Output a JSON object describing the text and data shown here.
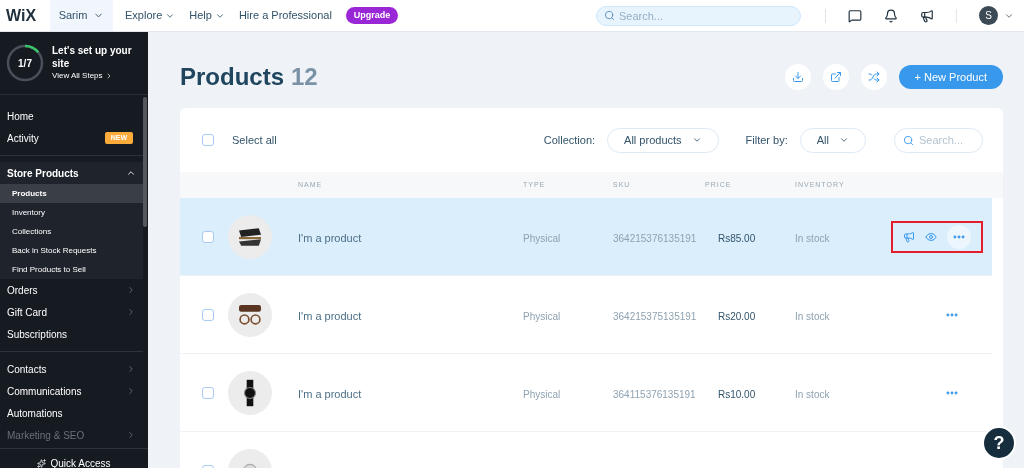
{
  "topbar": {
    "logo": "WiX",
    "site": "Sarim",
    "menu": [
      {
        "label": "Explore",
        "dropdown": true
      },
      {
        "label": "Help",
        "dropdown": true
      },
      {
        "label": "Hire a Professional",
        "dropdown": false
      }
    ],
    "upgrade": "Upgrade",
    "search": {
      "placeholder": "Search..."
    },
    "avatar": "S"
  },
  "setup": {
    "progress": "1/7",
    "level": 0.14,
    "title": "Let's set up your site",
    "link": "View All Steps"
  },
  "sidebar": {
    "sections": [
      [
        {
          "label": "Home",
          "kind": "link",
          "disabled": false
        },
        {
          "label": "Activity",
          "kind": "link",
          "badge": "NEW",
          "disabled": false
        }
      ],
      [
        {
          "label": "Store Products",
          "kind": "group",
          "expanded": true,
          "disabled": false,
          "children": [
            {
              "label": "Products",
              "selected": true
            },
            {
              "label": "Inventory",
              "selected": false
            },
            {
              "label": "Collections",
              "selected": false
            },
            {
              "label": "Back in Stock Requests",
              "selected": false
            },
            {
              "label": "Find Products to Sell",
              "selected": false
            }
          ]
        },
        {
          "label": "Orders",
          "kind": "submenu",
          "disabled": false
        },
        {
          "label": "Gift Card",
          "kind": "submenu",
          "disabled": false
        },
        {
          "label": "Subscriptions",
          "kind": "link",
          "disabled": false
        }
      ],
      [
        {
          "label": "Contacts",
          "kind": "submenu",
          "disabled": false
        },
        {
          "label": "Communications",
          "kind": "submenu",
          "disabled": false
        },
        {
          "label": "Automations",
          "kind": "link",
          "disabled": false
        },
        {
          "label": "Marketing & SEO",
          "kind": "submenu",
          "disabled": true
        }
      ]
    ],
    "quick_access": "Quick Access"
  },
  "page": {
    "title": "Products",
    "count": "12",
    "new_button": "+ New Product"
  },
  "toolbar": {
    "select_all_checked": false,
    "select_all": "Select all",
    "collection_label": "Collection:",
    "collection_value": "All products",
    "filter_label": "Filter by:",
    "filter_value": "All",
    "search": {
      "placeholder": "Search..."
    }
  },
  "table": {
    "columns": [
      "NAME",
      "TYPE",
      "SKU",
      "PRICE",
      "INVENTORY"
    ],
    "rows": [
      {
        "name": "I'm a product",
        "type": "Physical",
        "sku": "364215376135191",
        "price": "Rs85.00",
        "inventory": "In stock",
        "hovered": true,
        "annotated": true,
        "checked": false
      },
      {
        "name": "I'm a product",
        "type": "Physical",
        "sku": "364215375135191",
        "price": "Rs20.00",
        "inventory": "In stock",
        "hovered": false,
        "annotated": false,
        "checked": false
      },
      {
        "name": "I'm a product",
        "type": "Physical",
        "sku": "364115376135191",
        "price": "Rs10.00",
        "inventory": "In stock",
        "hovered": false,
        "annotated": false,
        "checked": false
      },
      {
        "checked": false
      }
    ]
  },
  "help": "?"
}
